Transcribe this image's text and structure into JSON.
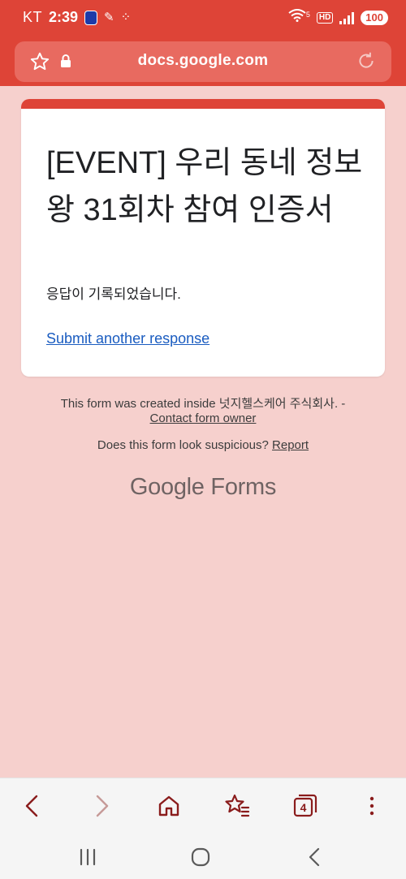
{
  "status_bar": {
    "carrier": "KT",
    "time": "2:39",
    "hd_badge": "HD",
    "battery": "100",
    "wifi_badge": "5"
  },
  "browser": {
    "url": "docs.google.com",
    "tab_count": "4"
  },
  "form": {
    "title": "[EVENT] 우리 동네 정보왕 31회차 참여 인증서",
    "confirmation": "응답이 기록되었습니다.",
    "submit_another": "Submit another response"
  },
  "footer": {
    "created_inside": "This form was created inside 넛지헬스케어 주식회사. -",
    "contact_owner": "Contact form owner",
    "suspicious": "Does this form look suspicious?",
    "report": "Report",
    "logo_google": "Google",
    "logo_forms": "Forms"
  },
  "colors": {
    "accent": "#de4437",
    "background": "#f6d0cd",
    "link": "#1a5cc0",
    "nav_icon": "#8a1c1c"
  },
  "icons": {
    "url_bar": [
      "star-icon",
      "lock-icon",
      "reload-icon"
    ],
    "nav": [
      "back-icon",
      "forward-icon",
      "home-icon",
      "bookmarks-icon",
      "tabs-icon",
      "more-icon"
    ],
    "system": [
      "recent-apps-icon",
      "home-circle-icon",
      "system-back-icon"
    ]
  }
}
